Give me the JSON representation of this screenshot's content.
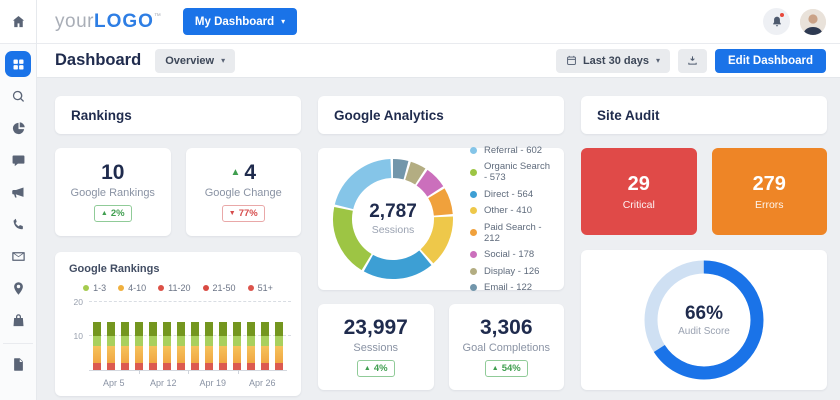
{
  "topbar": {
    "logo_prefix": "your",
    "logo_main": "LOGO",
    "logo_tm": "™",
    "dashboard_button": "My Dashboard",
    "notification_alert": true
  },
  "sidebar": {
    "items": [
      {
        "icon": "dashboard-grid",
        "active": true
      },
      {
        "icon": "search",
        "active": false
      },
      {
        "icon": "pie-chart",
        "active": false
      },
      {
        "icon": "chat-bubble",
        "active": false
      },
      {
        "icon": "megaphone",
        "active": false
      },
      {
        "icon": "phone",
        "active": false
      },
      {
        "icon": "mail",
        "active": false
      },
      {
        "icon": "location-pin",
        "active": false
      },
      {
        "icon": "shopping-bag",
        "active": false
      },
      {
        "icon": "document",
        "active": false,
        "divided": true
      }
    ]
  },
  "pagebar": {
    "title": "Dashboard",
    "view_selector": "Overview",
    "date_range": "Last 30 days",
    "edit_button": "Edit Dashboard"
  },
  "rankings": {
    "title": "Rankings",
    "stats": [
      {
        "value": "10",
        "trend": null,
        "label": "Google Rankings",
        "badge": {
          "dir": "up",
          "text": "2%",
          "color": "green"
        }
      },
      {
        "value": "4",
        "trend": "up",
        "label": "Google Change",
        "badge": {
          "dir": "down",
          "text": "77%",
          "color": "red"
        }
      }
    ]
  },
  "analytics": {
    "title": "Google Analytics",
    "stats": [
      {
        "value": "23,997",
        "trend": null,
        "label": "Sessions",
        "badge": {
          "dir": "up",
          "text": "4%",
          "color": "green"
        }
      },
      {
        "value": "3,306",
        "trend": null,
        "label": "Goal Completions",
        "badge": {
          "dir": "up",
          "text": "54%",
          "color": "green"
        }
      }
    ]
  },
  "site_audit": {
    "title": "Site Audit",
    "tiles": [
      {
        "value": "29",
        "label": "Critical",
        "color": "#e04a48"
      },
      {
        "value": "279",
        "label": "Errors",
        "color": "#ee8526"
      }
    ]
  },
  "chart_data": [
    {
      "type": "bar",
      "id": "google-rankings",
      "title": "Google Rankings",
      "legend": [
        {
          "label": "1-3",
          "color": "#a5cb4e"
        },
        {
          "label": "4-10",
          "color": "#f0b03e"
        },
        {
          "label": "11-20",
          "color": "#dc5046"
        },
        {
          "label": "21-50",
          "color": "#d94a42"
        },
        {
          "label": "51+",
          "color": "#dc544c"
        }
      ],
      "y_ticks": [
        10,
        20
      ],
      "y_max": 20,
      "x_labels": [
        "Apr 5",
        "Apr 12",
        "Apr 19",
        "Apr 26"
      ],
      "bar_count": 14,
      "stack_bottom_to_top": [
        {
          "name": "red",
          "color": "#dc5a50",
          "value": 2
        },
        {
          "name": "orange",
          "color": "#f1a743",
          "value": 5
        },
        {
          "name": "light-green",
          "color": "#a9d05e",
          "value": 3
        },
        {
          "name": "dark-green",
          "color": "#74961f",
          "value": 4
        }
      ],
      "grid": "dashed"
    },
    {
      "type": "donut",
      "id": "traffic-sources",
      "center_value": "2,787",
      "center_label": "Sessions",
      "total": 2787,
      "segments": [
        {
          "name": "Referral",
          "value": 602,
          "color": "#85c5e8"
        },
        {
          "name": "Organic Search",
          "value": 573,
          "color": "#9dc544"
        },
        {
          "name": "Direct",
          "value": 564,
          "color": "#3d9fd4"
        },
        {
          "name": "Other",
          "value": 410,
          "color": "#eec84a"
        },
        {
          "name": "Paid Search",
          "value": 212,
          "color": "#f0a13c"
        },
        {
          "name": "Social",
          "value": 178,
          "color": "#cb6fbc"
        },
        {
          "name": "Display",
          "value": 126,
          "color": "#b3ad82"
        },
        {
          "name": "Email",
          "value": 122,
          "color": "#7296ab"
        }
      ],
      "legend_separator": " - ",
      "clockwise_from_top": "reverse-of-legend-order",
      "legend_position": "right"
    },
    {
      "type": "donut",
      "id": "audit-score",
      "percent": 66,
      "center_value": "66%",
      "center_label": "Audit Score",
      "progress_color": "#1a73e8",
      "track_color": "#cfe0f3"
    }
  ]
}
